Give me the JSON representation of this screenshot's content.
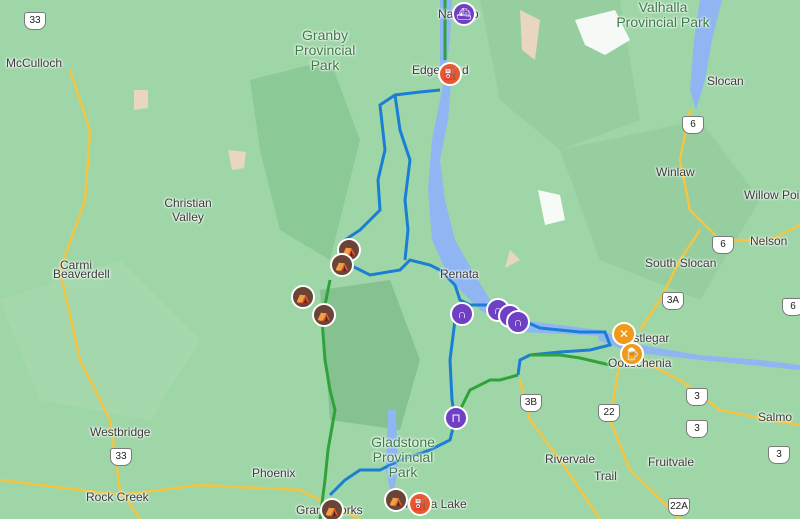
{
  "colors": {
    "water": "#8fb6f2",
    "route_blue": "#1a7fd4",
    "route_green": "#2fa33a",
    "road": "#f4c542",
    "camp": "#6b4438",
    "tunnel": "#6f3fc4",
    "fuel": "#e45c2d",
    "food": "#f09a1a"
  },
  "places": {
    "nakusp": "Nakusp",
    "valhalla_park": "Valhalla Provincial Park",
    "granby_park": "Granby Provincial Park",
    "mcculloch": "McCulloch",
    "edgewood": "Edgewood",
    "slocan": "Slocan",
    "christian_valley": "Christian Valley",
    "winlaw": "Winlaw",
    "willow_point": "Willow Poi",
    "carmi": "Carmi",
    "beaverdell": "Beaverdell",
    "nelson": "Nelson",
    "south_slocan": "South Slocan",
    "renata": "Renata",
    "castlegar": "Castlegar",
    "ootischenia": "Ootischenia",
    "westbridge": "Westbridge",
    "gladstone_park": "Gladstone Provincial Park",
    "rivervale": "Rivervale",
    "fruitvale": "Fruitvale",
    "salmo": "Salmo",
    "phoenix": "Phoenix",
    "trail": "Trail",
    "rock_creek": "Rock Creek",
    "grand_forks": "Grand Forks",
    "christina_lake": "Christina Lake"
  },
  "shields": {
    "s33a": "33",
    "s6a": "6",
    "s6b": "6",
    "s3a": "3A",
    "s3b": "3B",
    "s22": "22",
    "s3": "3",
    "s3c": "3",
    "s33b": "33",
    "s3d": "3",
    "s22a": "22A",
    "s6c": "6"
  },
  "icons": {
    "camp_icon": "tent-icon",
    "tunnel_icon": "tunnel-icon",
    "fuel_icon": "fuel-pump-icon",
    "ferry_icon": "ferry-icon",
    "food_icon": "fork-knife-icon",
    "beer_icon": "beer-mug-icon"
  }
}
